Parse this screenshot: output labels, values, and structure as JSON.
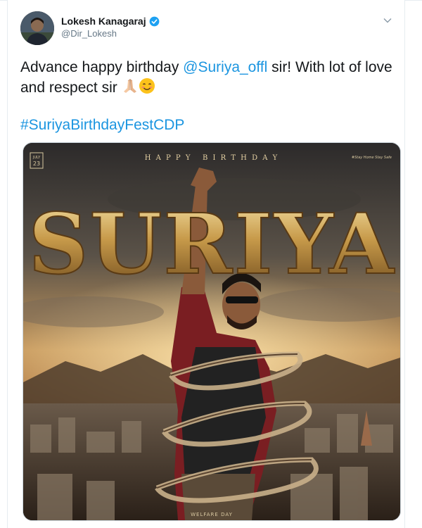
{
  "tweet": {
    "author_name": "Lokesh Kanagaraj",
    "author_handle": "@Dir_Lokesh",
    "text_before": "Advance happy birthday ",
    "mention": "@Suriya_offl",
    "text_after": " sir! With lot of love and respect sir ",
    "hashtag": "#SuriyaBirthdayFestCDP"
  },
  "poster": {
    "top_banner": "H A P P Y   B I R T H D A Y",
    "date_line1": "JULY",
    "date_line2": "23",
    "corner_tag": "#Stay Home Stay Safe",
    "title": "SURIYA",
    "bottom_text": "WELFARE DAY"
  },
  "colors": {
    "link": "#1b95e0",
    "text": "#14171a",
    "muted": "#657786",
    "verified": "#1da1f2"
  },
  "icons": {
    "verified": "verified-badge-icon",
    "caret": "chevron-down-icon",
    "emoji1": "folded-hands-emoji",
    "emoji2": "smiling-face-emoji"
  }
}
